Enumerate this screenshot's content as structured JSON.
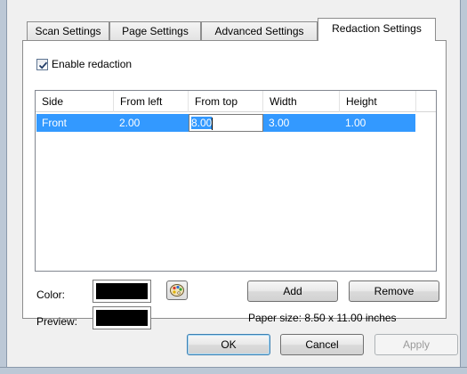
{
  "tabs": [
    {
      "label": "Scan Settings",
      "active": false
    },
    {
      "label": "Page Settings",
      "active": false
    },
    {
      "label": "Advanced Settings",
      "active": false
    },
    {
      "label": "Redaction Settings",
      "active": true
    }
  ],
  "enable_redaction": {
    "label": "Enable redaction",
    "checked": true
  },
  "redaction_table": {
    "columns": [
      "Side",
      "From left",
      "From top",
      "Width",
      "Height"
    ],
    "rows": [
      {
        "side": "Front",
        "from_left": "2.00",
        "from_top": "8.00",
        "width": "3.00",
        "height": "1.00",
        "selected": true
      }
    ],
    "editing_cell": "from_top"
  },
  "color": {
    "label": "Color:",
    "value": "#000000"
  },
  "preview": {
    "label": "Preview:",
    "value": "#000000"
  },
  "palette_icon": "palette-icon",
  "actions": {
    "add": "Add",
    "remove": "Remove"
  },
  "paper_size": "Paper size:  8.50 x 11.00 inches",
  "dialog_buttons": {
    "ok": "OK",
    "cancel": "Cancel",
    "apply": "Apply"
  },
  "colors": {
    "selection": "#3399ff",
    "panel": "#ffffff",
    "dialog": "#f0f0f0"
  }
}
